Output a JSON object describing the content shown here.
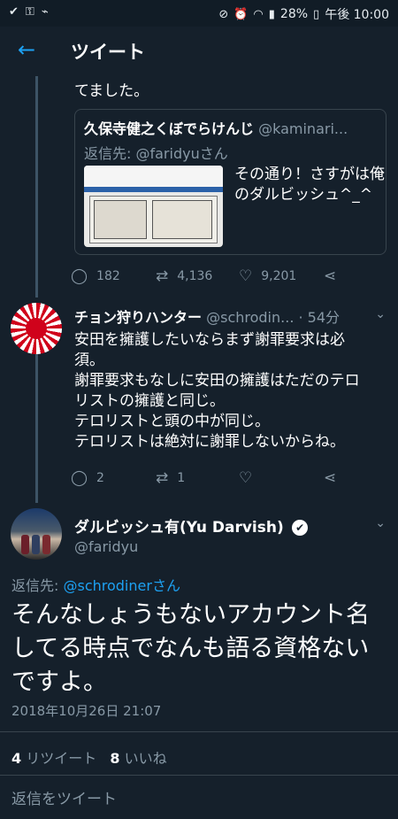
{
  "status_bar": {
    "left_icons": [
      "check-icon",
      "key-icon",
      "pulse-icon"
    ],
    "battery": "28%",
    "time": "午後 10:00"
  },
  "header": {
    "title": "ツイート"
  },
  "context_tweet": {
    "text_tail": "てました。",
    "quote": {
      "name": "久保寺健之くぼでらけんじ",
      "handle": "@kaminari...",
      "reply_prefix": "返信先: ",
      "reply_to": "@faridyuさん",
      "text": "その通り！さすがは俺のダルビッシュ^_^"
    },
    "counts": {
      "replies": "182",
      "retweets": "4,136",
      "likes": "9,201"
    }
  },
  "reply_tweet": {
    "name": "チョン狩りハンター",
    "handle": "@schrodin...",
    "time": "· 54分",
    "lines": [
      "安田を擁護したいならまず謝罪要求は必",
      "須。",
      "謝罪要求もなしに安田の擁護はただのテロ",
      "リストの擁護と同じ。",
      "テロリストと頭の中が同じ。",
      "テロリストは絶対に謝罪しないからね。"
    ],
    "counts": {
      "replies": "2",
      "retweets": "1",
      "likes": ""
    }
  },
  "main_tweet": {
    "name": "ダルビッシュ有(Yu Darvish)",
    "handle": "@faridyu",
    "reply_prefix": "返信先: ",
    "reply_to": "@schrodinerさん",
    "lines": [
      "そんなしょうもないアカウント名",
      "してる時点でなんも語る資格ない",
      "ですよ。"
    ],
    "timestamp": "2018年10月26日 21:07",
    "retweet_count": "4",
    "retweet_label": "リツイート",
    "like_count": "8",
    "like_label": "いいね"
  },
  "compose": {
    "placeholder": "返信をツイート"
  },
  "colors": {
    "background": "#15202b",
    "accent": "#1da1f2",
    "muted": "#8899a6",
    "border": "#38444d"
  }
}
